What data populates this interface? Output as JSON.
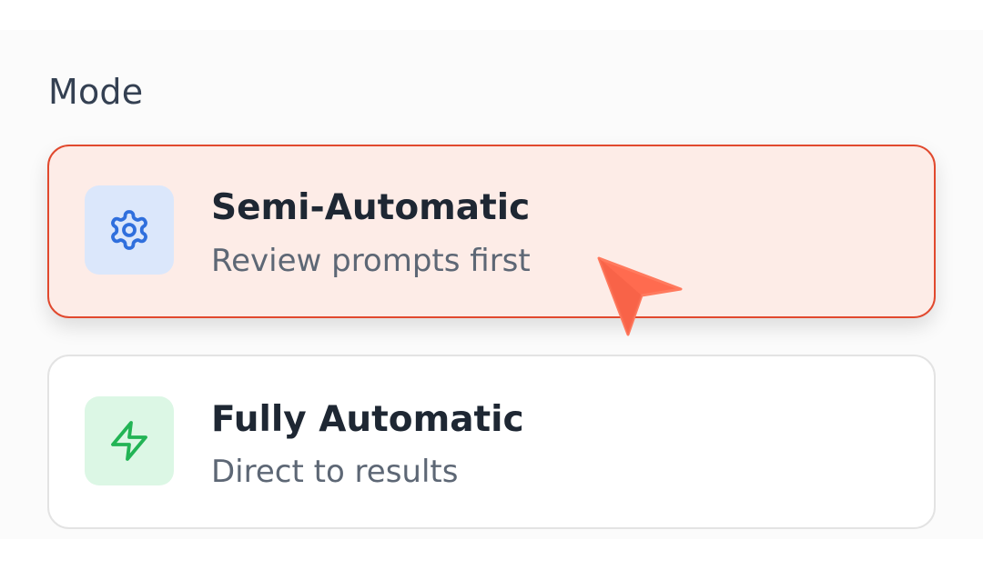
{
  "section": {
    "title": "Mode"
  },
  "modes": [
    {
      "title": "Semi-Automatic",
      "subtitle": "Review prompts first",
      "icon": "gear-icon",
      "selected": true,
      "icon_color": "#2f6fdd",
      "icon_bg": "#dbe7fb"
    },
    {
      "title": "Fully Automatic",
      "subtitle": "Direct to results",
      "icon": "lightning-icon",
      "selected": false,
      "icon_color": "#22b455",
      "icon_bg": "#dcf7e5"
    }
  ],
  "colors": {
    "selected_border": "#e1492e",
    "selected_background": "#fdece7",
    "cursor": "#ff6b4f"
  }
}
